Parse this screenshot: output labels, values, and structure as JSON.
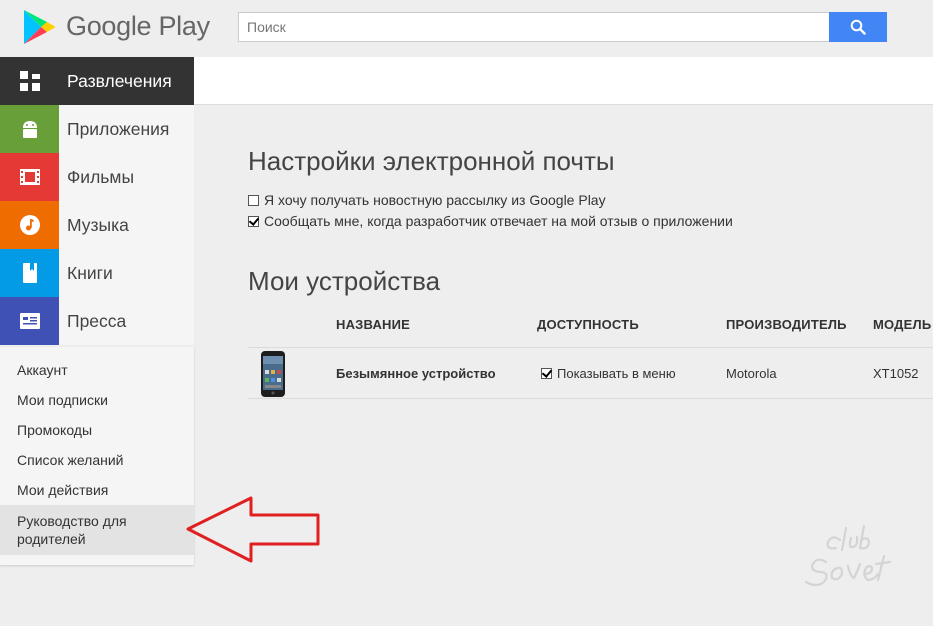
{
  "header": {
    "logo_text": "Google Play",
    "search_placeholder": "Поиск",
    "search_value": ""
  },
  "sidebar": {
    "categories": [
      {
        "label": "Развлечения",
        "color": "#333333",
        "icon": "apps-grid-icon"
      },
      {
        "label": "Приложения",
        "color": "#689f38",
        "icon": "android-icon"
      },
      {
        "label": "Фильмы",
        "color": "#e53935",
        "icon": "film-icon"
      },
      {
        "label": "Музыка",
        "color": "#ef6c00",
        "icon": "music-note-icon"
      },
      {
        "label": "Книги",
        "color": "#039be5",
        "icon": "book-icon"
      },
      {
        "label": "Пресса",
        "color": "#3f51b5",
        "icon": "newspaper-icon"
      }
    ],
    "menu": [
      {
        "label": "Аккаунт"
      },
      {
        "label": "Мои подписки"
      },
      {
        "label": "Промокоды"
      },
      {
        "label": "Список желаний"
      },
      {
        "label": "Мои действия"
      },
      {
        "label": "Руководство для родителей"
      }
    ]
  },
  "email_settings": {
    "title": "Настройки электронной почты",
    "options": [
      {
        "label": "Я хочу получать новостную рассылку из Google Play",
        "checked": false
      },
      {
        "label": "Сообщать мне, когда разработчик отвечает на мой отзыв о приложении",
        "checked": true
      }
    ]
  },
  "devices": {
    "title": "Мои устройства",
    "columns": [
      "НАЗВАНИЕ",
      "ДОСТУПНОСТЬ",
      "ПРОИЗВОДИТЕЛЬ",
      "МОДЕЛЬ"
    ],
    "rows": [
      {
        "name": "Безымянное устройство",
        "availability": "Показывать в меню",
        "availability_checked": true,
        "manufacturer": "Motorola",
        "model": "XT1052"
      }
    ]
  },
  "colors": {
    "accent": "#4285f4",
    "arrow": "#e02020"
  }
}
